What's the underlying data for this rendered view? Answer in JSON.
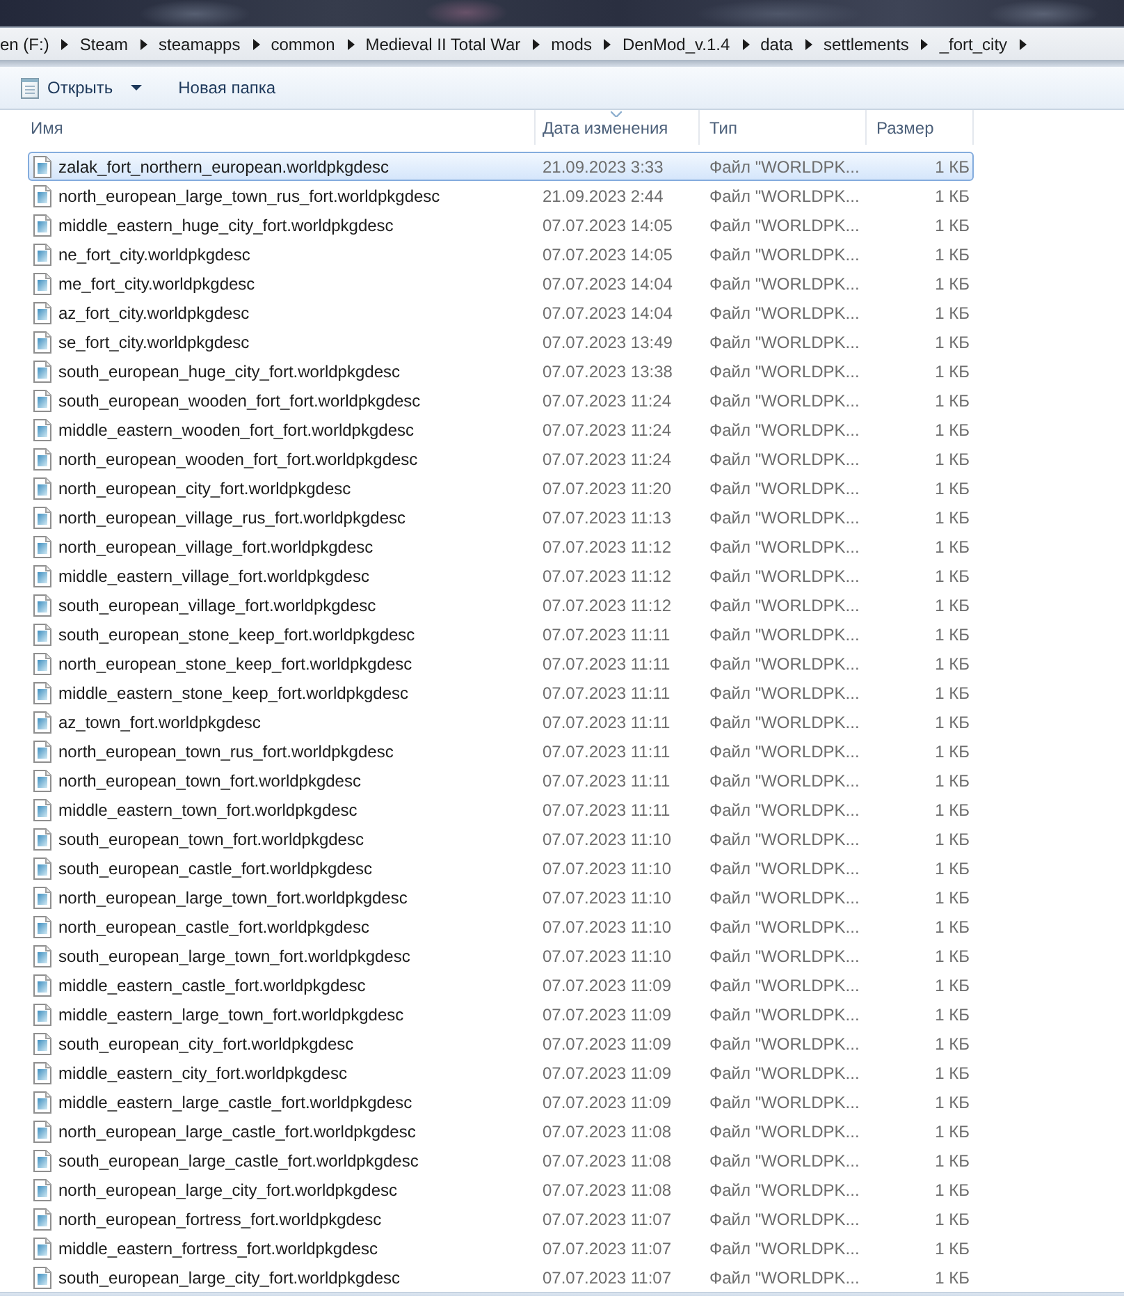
{
  "address_bar": {
    "segments": [
      "en (F:)",
      "Steam",
      "steamapps",
      "common",
      "Medieval II Total War",
      "mods",
      "DenMod_v.1.4",
      "data",
      "settlements",
      "_fort_city"
    ]
  },
  "toolbar": {
    "buttons": [
      {
        "label": "Открыть",
        "kind": "menu"
      },
      {
        "label": "Новая папка",
        "kind": "plain"
      }
    ]
  },
  "columns": [
    {
      "label": "Имя",
      "sorted": false
    },
    {
      "label": "Дата изменения",
      "sorted": true
    },
    {
      "label": "Тип",
      "sorted": false
    },
    {
      "label": "Размер",
      "sorted": false
    }
  ],
  "files": [
    {
      "name": "zalak_fort_northern_european.worldpkgdesc",
      "modified": "21.09.2023 3:33",
      "type": "Файл \"WORLDPK...",
      "size": "1 КБ",
      "selected": true
    },
    {
      "name": "north_european_large_town_rus_fort.worldpkgdesc",
      "modified": "21.09.2023 2:44",
      "type": "Файл \"WORLDPK...",
      "size": "1 КБ",
      "selected": false
    },
    {
      "name": "middle_eastern_huge_city_fort.worldpkgdesc",
      "modified": "07.07.2023 14:05",
      "type": "Файл \"WORLDPK...",
      "size": "1 КБ",
      "selected": false
    },
    {
      "name": "ne_fort_city.worldpkgdesc",
      "modified": "07.07.2023 14:05",
      "type": "Файл \"WORLDPK...",
      "size": "1 КБ",
      "selected": false
    },
    {
      "name": "me_fort_city.worldpkgdesc",
      "modified": "07.07.2023 14:04",
      "type": "Файл \"WORLDPK...",
      "size": "1 КБ",
      "selected": false
    },
    {
      "name": "az_fort_city.worldpkgdesc",
      "modified": "07.07.2023 14:04",
      "type": "Файл \"WORLDPK...",
      "size": "1 КБ",
      "selected": false
    },
    {
      "name": "se_fort_city.worldpkgdesc",
      "modified": "07.07.2023 13:49",
      "type": "Файл \"WORLDPK...",
      "size": "1 КБ",
      "selected": false
    },
    {
      "name": "south_european_huge_city_fort.worldpkgdesc",
      "modified": "07.07.2023 13:38",
      "type": "Файл \"WORLDPK...",
      "size": "1 КБ",
      "selected": false
    },
    {
      "name": "south_european_wooden_fort_fort.worldpkgdesc",
      "modified": "07.07.2023 11:24",
      "type": "Файл \"WORLDPK...",
      "size": "1 КБ",
      "selected": false
    },
    {
      "name": "middle_eastern_wooden_fort_fort.worldpkgdesc",
      "modified": "07.07.2023 11:24",
      "type": "Файл \"WORLDPK...",
      "size": "1 КБ",
      "selected": false
    },
    {
      "name": "north_european_wooden_fort_fort.worldpkgdesc",
      "modified": "07.07.2023 11:24",
      "type": "Файл \"WORLDPK...",
      "size": "1 КБ",
      "selected": false
    },
    {
      "name": "north_european_city_fort.worldpkgdesc",
      "modified": "07.07.2023 11:20",
      "type": "Файл \"WORLDPK...",
      "size": "1 КБ",
      "selected": false
    },
    {
      "name": "north_european_village_rus_fort.worldpkgdesc",
      "modified": "07.07.2023 11:13",
      "type": "Файл \"WORLDPK...",
      "size": "1 КБ",
      "selected": false
    },
    {
      "name": "north_european_village_fort.worldpkgdesc",
      "modified": "07.07.2023 11:12",
      "type": "Файл \"WORLDPK...",
      "size": "1 КБ",
      "selected": false
    },
    {
      "name": "middle_eastern_village_fort.worldpkgdesc",
      "modified": "07.07.2023 11:12",
      "type": "Файл \"WORLDPK...",
      "size": "1 КБ",
      "selected": false
    },
    {
      "name": "south_european_village_fort.worldpkgdesc",
      "modified": "07.07.2023 11:12",
      "type": "Файл \"WORLDPK...",
      "size": "1 КБ",
      "selected": false
    },
    {
      "name": "south_european_stone_keep_fort.worldpkgdesc",
      "modified": "07.07.2023 11:11",
      "type": "Файл \"WORLDPK...",
      "size": "1 КБ",
      "selected": false
    },
    {
      "name": "north_european_stone_keep_fort.worldpkgdesc",
      "modified": "07.07.2023 11:11",
      "type": "Файл \"WORLDPK...",
      "size": "1 КБ",
      "selected": false
    },
    {
      "name": "middle_eastern_stone_keep_fort.worldpkgdesc",
      "modified": "07.07.2023 11:11",
      "type": "Файл \"WORLDPK...",
      "size": "1 КБ",
      "selected": false
    },
    {
      "name": "az_town_fort.worldpkgdesc",
      "modified": "07.07.2023 11:11",
      "type": "Файл \"WORLDPK...",
      "size": "1 КБ",
      "selected": false
    },
    {
      "name": "north_european_town_rus_fort.worldpkgdesc",
      "modified": "07.07.2023 11:11",
      "type": "Файл \"WORLDPK...",
      "size": "1 КБ",
      "selected": false
    },
    {
      "name": "north_european_town_fort.worldpkgdesc",
      "modified": "07.07.2023 11:11",
      "type": "Файл \"WORLDPK...",
      "size": "1 КБ",
      "selected": false
    },
    {
      "name": "middle_eastern_town_fort.worldpkgdesc",
      "modified": "07.07.2023 11:11",
      "type": "Файл \"WORLDPK...",
      "size": "1 КБ",
      "selected": false
    },
    {
      "name": "south_european_town_fort.worldpkgdesc",
      "modified": "07.07.2023 11:10",
      "type": "Файл \"WORLDPK...",
      "size": "1 КБ",
      "selected": false
    },
    {
      "name": "south_european_castle_fort.worldpkgdesc",
      "modified": "07.07.2023 11:10",
      "type": "Файл \"WORLDPK...",
      "size": "1 КБ",
      "selected": false
    },
    {
      "name": "north_european_large_town_fort.worldpkgdesc",
      "modified": "07.07.2023 11:10",
      "type": "Файл \"WORLDPK...",
      "size": "1 КБ",
      "selected": false
    },
    {
      "name": "north_european_castle_fort.worldpkgdesc",
      "modified": "07.07.2023 11:10",
      "type": "Файл \"WORLDPK...",
      "size": "1 КБ",
      "selected": false
    },
    {
      "name": "south_european_large_town_fort.worldpkgdesc",
      "modified": "07.07.2023 11:10",
      "type": "Файл \"WORLDPK...",
      "size": "1 КБ",
      "selected": false
    },
    {
      "name": "middle_eastern_castle_fort.worldpkgdesc",
      "modified": "07.07.2023 11:09",
      "type": "Файл \"WORLDPK...",
      "size": "1 КБ",
      "selected": false
    },
    {
      "name": "middle_eastern_large_town_fort.worldpkgdesc",
      "modified": "07.07.2023 11:09",
      "type": "Файл \"WORLDPK...",
      "size": "1 КБ",
      "selected": false
    },
    {
      "name": "south_european_city_fort.worldpkgdesc",
      "modified": "07.07.2023 11:09",
      "type": "Файл \"WORLDPK...",
      "size": "1 КБ",
      "selected": false
    },
    {
      "name": "middle_eastern_city_fort.worldpkgdesc",
      "modified": "07.07.2023 11:09",
      "type": "Файл \"WORLDPK...",
      "size": "1 КБ",
      "selected": false
    },
    {
      "name": "middle_eastern_large_castle_fort.worldpkgdesc",
      "modified": "07.07.2023 11:09",
      "type": "Файл \"WORLDPK...",
      "size": "1 КБ",
      "selected": false
    },
    {
      "name": "north_european_large_castle_fort.worldpkgdesc",
      "modified": "07.07.2023 11:08",
      "type": "Файл \"WORLDPK...",
      "size": "1 КБ",
      "selected": false
    },
    {
      "name": "south_european_large_castle_fort.worldpkgdesc",
      "modified": "07.07.2023 11:08",
      "type": "Файл \"WORLDPK...",
      "size": "1 КБ",
      "selected": false
    },
    {
      "name": "north_european_large_city_fort.worldpkgdesc",
      "modified": "07.07.2023 11:08",
      "type": "Файл \"WORLDPK...",
      "size": "1 КБ",
      "selected": false
    },
    {
      "name": "north_european_fortress_fort.worldpkgdesc",
      "modified": "07.07.2023 11:07",
      "type": "Файл \"WORLDPK...",
      "size": "1 КБ",
      "selected": false
    },
    {
      "name": "middle_eastern_fortress_fort.worldpkgdesc",
      "modified": "07.07.2023 11:07",
      "type": "Файл \"WORLDPK...",
      "size": "1 КБ",
      "selected": false
    },
    {
      "name": "south_european_large_city_fort.worldpkgdesc",
      "modified": "07.07.2023 11:07",
      "type": "Файл \"WORLDPK...",
      "size": "1 КБ",
      "selected": false
    }
  ]
}
